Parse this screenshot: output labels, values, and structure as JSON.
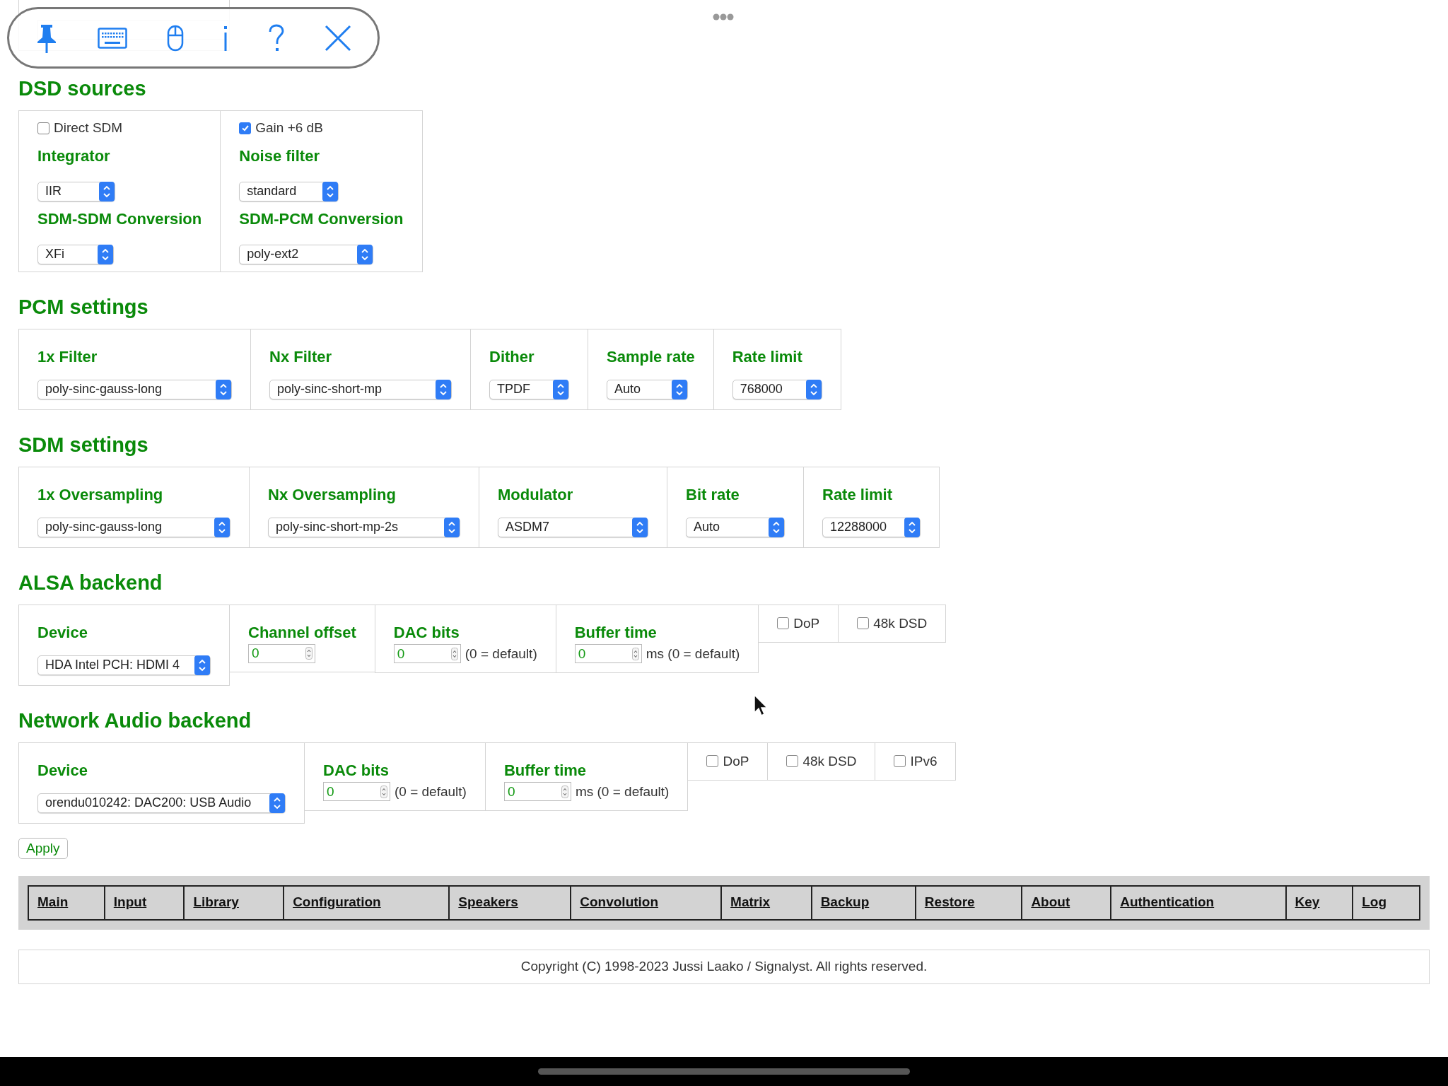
{
  "sections": [
    {
      "title": "DSD sources",
      "cells": [
        {
          "items": [
            {
              "kind": "checkbox",
              "label": "Direct SDM",
              "checked": false
            },
            {
              "kind": "label",
              "text": "Integrator"
            },
            {
              "kind": "select",
              "value": "IIR"
            },
            {
              "kind": "label",
              "text": "SDM-SDM Conversion"
            },
            {
              "kind": "select",
              "value": "XFi"
            }
          ]
        },
        {
          "items": [
            {
              "kind": "checkbox",
              "label": "Gain +6 dB",
              "checked": true
            },
            {
              "kind": "label",
              "text": "Noise filter"
            },
            {
              "kind": "select",
              "value": "standard"
            },
            {
              "kind": "label",
              "text": "SDM-PCM Conversion"
            },
            {
              "kind": "select",
              "value": "poly-ext2"
            }
          ]
        }
      ]
    },
    {
      "title": "PCM settings",
      "cells": [
        {
          "items": [
            {
              "kind": "label",
              "text": "1x Filter"
            },
            {
              "kind": "select",
              "value": "poly-sinc-gauss-long"
            }
          ]
        },
        {
          "items": [
            {
              "kind": "label",
              "text": "Nx Filter"
            },
            {
              "kind": "select",
              "value": "poly-sinc-short-mp"
            }
          ]
        },
        {
          "items": [
            {
              "kind": "label",
              "text": "Dither"
            },
            {
              "kind": "select",
              "value": "TPDF"
            }
          ]
        },
        {
          "items": [
            {
              "kind": "label",
              "text": "Sample rate"
            },
            {
              "kind": "select",
              "value": "Auto"
            }
          ]
        },
        {
          "items": [
            {
              "kind": "label",
              "text": "Rate limit"
            },
            {
              "kind": "select",
              "value": "768000"
            }
          ]
        }
      ]
    },
    {
      "title": "SDM settings",
      "cells": [
        {
          "items": [
            {
              "kind": "label",
              "text": "1x Oversampling"
            },
            {
              "kind": "select",
              "value": "poly-sinc-gauss-long"
            }
          ]
        },
        {
          "items": [
            {
              "kind": "label",
              "text": "Nx Oversampling"
            },
            {
              "kind": "select",
              "value": "poly-sinc-short-mp-2s"
            }
          ]
        },
        {
          "items": [
            {
              "kind": "label",
              "text": "Modulator"
            },
            {
              "kind": "select",
              "value": "ASDM7"
            }
          ]
        },
        {
          "items": [
            {
              "kind": "label",
              "text": "Bit rate"
            },
            {
              "kind": "select",
              "value": "Auto"
            }
          ]
        },
        {
          "items": [
            {
              "kind": "label",
              "text": "Rate limit"
            },
            {
              "kind": "select",
              "value": "12288000"
            }
          ]
        }
      ]
    },
    {
      "title": "ALSA backend",
      "cells": [
        {
          "items": [
            {
              "kind": "label",
              "text": "Device"
            },
            {
              "kind": "select",
              "value": "HDA Intel PCH: HDMI 4"
            }
          ]
        },
        {
          "items": [
            {
              "kind": "label",
              "text": "Channel offset"
            },
            {
              "kind": "number",
              "value": "0"
            }
          ]
        },
        {
          "items": [
            {
              "kind": "label",
              "text": "DAC bits"
            },
            {
              "kind": "number",
              "value": "0",
              "note": "(0 = default)"
            }
          ]
        },
        {
          "items": [
            {
              "kind": "label",
              "text": "Buffer time"
            },
            {
              "kind": "number",
              "value": "0",
              "note": "ms (0 = default)"
            }
          ]
        },
        {
          "items": [
            {
              "kind": "checkbox",
              "label": "DoP",
              "checked": false
            }
          ]
        },
        {
          "items": [
            {
              "kind": "checkbox",
              "label": "48k DSD",
              "checked": false
            }
          ]
        }
      ]
    },
    {
      "title": "Network Audio backend",
      "cells": [
        {
          "items": [
            {
              "kind": "label",
              "text": "Device"
            },
            {
              "kind": "select",
              "value": "orendu010242: DAC200: USB Audio"
            }
          ]
        },
        {
          "items": [
            {
              "kind": "label",
              "text": "DAC bits"
            },
            {
              "kind": "number",
              "value": "0",
              "note": "(0 = default)"
            }
          ]
        },
        {
          "items": [
            {
              "kind": "label",
              "text": "Buffer time"
            },
            {
              "kind": "number",
              "value": "0",
              "note": "ms (0 = default)"
            }
          ]
        },
        {
          "items": [
            {
              "kind": "checkbox",
              "label": "DoP",
              "checked": false
            }
          ]
        },
        {
          "items": [
            {
              "kind": "checkbox",
              "label": "48k DSD",
              "checked": false
            }
          ]
        },
        {
          "items": [
            {
              "kind": "checkbox",
              "label": "IPv6",
              "checked": false
            }
          ]
        }
      ]
    }
  ],
  "apply_button": "Apply",
  "nav": [
    "Main",
    "Input",
    "Library",
    "Configuration",
    "Speakers",
    "Convolution",
    "Matrix",
    "Backup",
    "Restore",
    "About",
    "Authentication",
    "Key",
    "Log"
  ],
  "copyright": "Copyright (C) 1998-2023 Jussi Laako / Signalyst. All rights reserved."
}
